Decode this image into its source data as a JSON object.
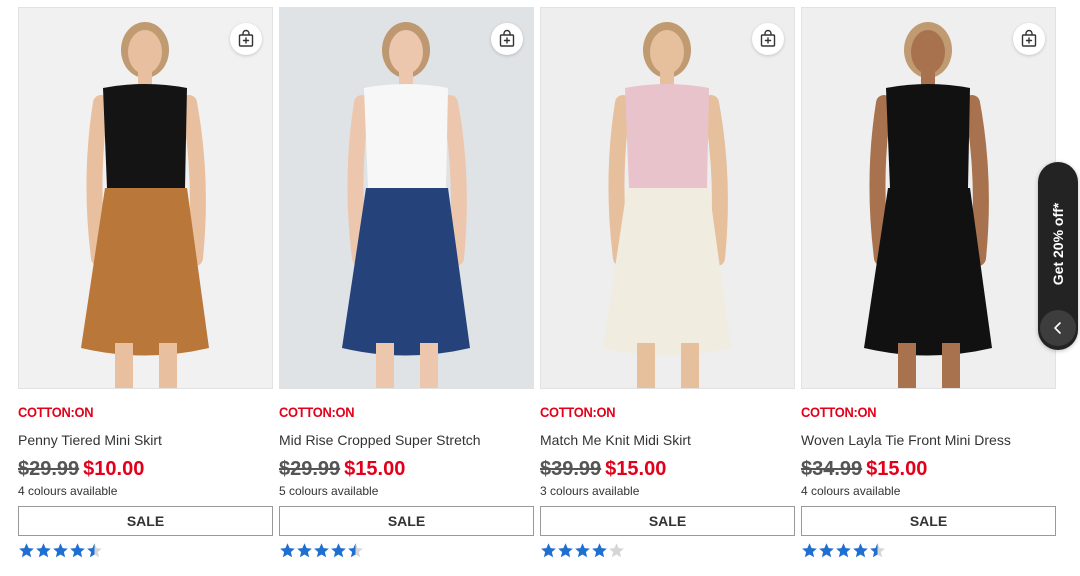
{
  "products": [
    {
      "brand": "COTTON:ON",
      "name": "Penny Tiered Mini Skirt",
      "was_price": "$29.99",
      "sale_price": "$10.00",
      "colours": "4 colours available",
      "sale_label": "SALE",
      "rating": 4.5,
      "bg": "#f1f1f1",
      "top_color": "#141414",
      "bottom_color": "#b9783a",
      "skin": "#e8c0a0"
    },
    {
      "brand": "COTTON:ON",
      "name": "Mid Rise Cropped Super Stretch",
      "was_price": "$29.99",
      "sale_price": "$15.00",
      "colours": "5 colours available",
      "sale_label": "SALE",
      "rating": 4.5,
      "bg": "#dfe3e6",
      "top_color": "#f7f7f7",
      "bottom_color": "#26427a",
      "skin": "#ecc7ad"
    },
    {
      "brand": "COTTON:ON",
      "name": "Match Me Knit Midi Skirt",
      "was_price": "$39.99",
      "sale_price": "$15.00",
      "colours": "3 colours available",
      "sale_label": "SALE",
      "rating": 4,
      "bg": "#eeeeee",
      "top_color": "#e9c3cb",
      "bottom_color": "#f1ece0",
      "skin": "#e6bf9c"
    },
    {
      "brand": "COTTON:ON",
      "name": "Woven Layla Tie Front Mini Dress",
      "was_price": "$34.99",
      "sale_price": "$15.00",
      "colours": "4 colours available",
      "sale_label": "SALE",
      "rating": 4.5,
      "bg": "#efefef",
      "top_color": "#111111",
      "bottom_color": "#111111",
      "skin": "#a9724f"
    }
  ],
  "promo": {
    "label": "Get 20% off*"
  },
  "colors": {
    "accent_red": "#e3001b",
    "star_blue": "#1f6fd1",
    "star_empty": "#d6d6d6"
  },
  "icons": {
    "add_to_bag": "shopping-bag-plus-icon",
    "collapse": "chevron-left-icon",
    "rating": "star-icon"
  }
}
